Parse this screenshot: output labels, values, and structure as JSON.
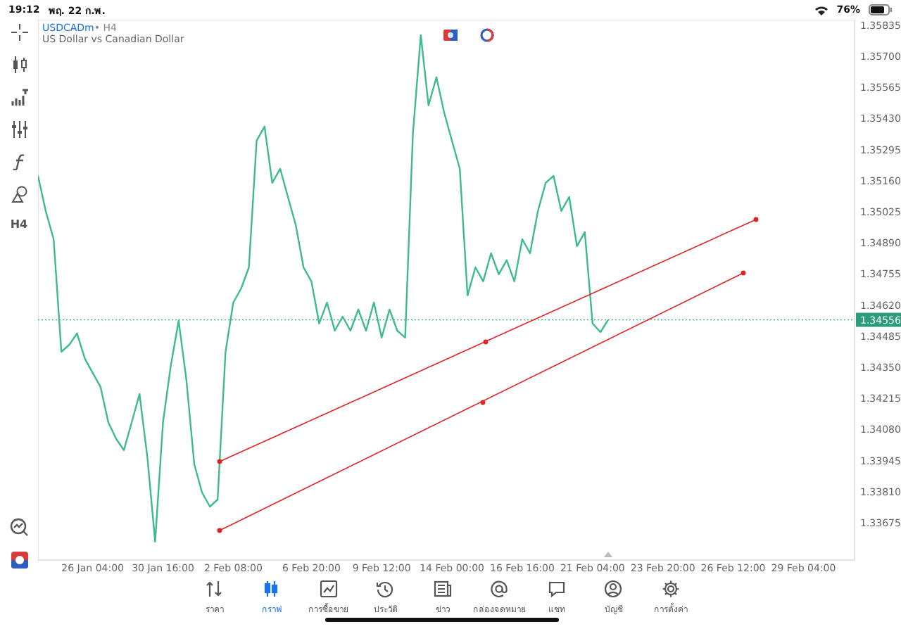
{
  "status_bar": {
    "time": "19:12",
    "date": "พฤ. 22 ก.พ.",
    "battery": "76%"
  },
  "toolbar": {
    "timeframe": "H4"
  },
  "chart": {
    "symbol": "USDCADm",
    "separator": "•",
    "timeframe": "H4",
    "description": "US Dollar vs Canadian Dollar",
    "current_price": "1.34556",
    "drawings": [
      {
        "kind": "trendline"
      },
      {
        "kind": "trendline"
      }
    ],
    "chart_data": {
      "type": "line",
      "ylim": [
        1.33513,
        1.35859
      ],
      "categories": [
        null,
        null,
        null,
        null,
        null,
        null,
        null,
        "26 Jan 04:00",
        null,
        null,
        null,
        null,
        null,
        null,
        null,
        null,
        "30 Jan 16:00",
        null,
        null,
        null,
        null,
        null,
        null,
        null,
        null,
        "2 Feb 08:00",
        null,
        null,
        null,
        null,
        null,
        null,
        null,
        null,
        null,
        "6 Feb 20:00",
        null,
        null,
        null,
        null,
        null,
        null,
        null,
        null,
        "9 Feb 12:00",
        null,
        null,
        null,
        null,
        null,
        null,
        null,
        null,
        "14 Feb 00:00",
        null,
        null,
        null,
        null,
        null,
        null,
        null,
        null,
        "16 Feb 16:00",
        null,
        null,
        null,
        null,
        null,
        null,
        null,
        null,
        "21 Feb 04:00",
        null,
        null,
        null,
        null,
        null,
        null,
        null,
        null,
        "23 Feb 20:00",
        null,
        null,
        null,
        null,
        null,
        null,
        null,
        null,
        "26 Feb 12:00",
        null,
        null,
        null,
        null,
        null,
        null,
        null,
        null,
        "29 Feb 04:00"
      ],
      "yticks": [
        {
          "value": 1.35835,
          "label": "1.35835"
        },
        {
          "value": 1.357,
          "label": "1.35700"
        },
        {
          "value": 1.35565,
          "label": "1.35565"
        },
        {
          "value": 1.3543,
          "label": "1.35430"
        },
        {
          "value": 1.35295,
          "label": "1.35295"
        },
        {
          "value": 1.3516,
          "label": "1.35160"
        },
        {
          "value": 1.35025,
          "label": "1.35025"
        },
        {
          "value": 1.3489,
          "label": "1.34890"
        },
        {
          "value": 1.34755,
          "label": "1.34755"
        },
        {
          "value": 1.3462,
          "label": "1.34620"
        },
        {
          "value": 1.34485,
          "label": "1.34485"
        },
        {
          "value": 1.3435,
          "label": "1.34350"
        },
        {
          "value": 1.34215,
          "label": "1.34215"
        },
        {
          "value": 1.3408,
          "label": "1.34080"
        },
        {
          "value": 1.33945,
          "label": "1.33945"
        },
        {
          "value": 1.3381,
          "label": "1.33810"
        },
        {
          "value": 1.33675,
          "label": "1.33675"
        }
      ],
      "series": [
        {
          "color": "#3dbb8c",
          "values": [
            1.35181,
            1.35028,
            1.34906,
            1.34417,
            1.34448,
            1.34497,
            1.34387,
            1.34326,
            1.34265,
            1.34112,
            1.34039,
            1.3399,
            1.34112,
            1.34234,
            1.33959,
            1.33593,
            1.34112,
            1.34356,
            1.34552,
            1.34295,
            1.33929,
            1.33806,
            1.33745,
            1.33776,
            1.34417,
            1.34631,
            1.34692,
            1.34784,
            1.35334,
            1.35395,
            1.35151,
            1.35212,
            1.3509,
            1.34967,
            1.34784,
            1.34723,
            1.3454,
            1.34631,
            1.34509,
            1.3457,
            1.34509,
            1.34601,
            1.34509,
            1.34631,
            1.34479,
            1.34601,
            1.34509,
            1.34479,
            1.35365,
            1.35792,
            1.35487,
            1.35609,
            1.35456,
            1.35334,
            1.35212,
            1.34662,
            1.34784,
            1.34723,
            1.34845,
            1.34754,
            1.34815,
            1.34723,
            1.34906,
            1.34845,
            1.35028,
            1.35151,
            1.35181,
            1.35028,
            1.3509,
            1.34876,
            1.34937,
            1.3454,
            1.34503,
            1.34556,
            null,
            null,
            null,
            null,
            null,
            null,
            null,
            null,
            null,
            null,
            null,
            null,
            null,
            null,
            null,
            null,
            null,
            null,
            null,
            null,
            null,
            null,
            null,
            null,
            null
          ]
        }
      ]
    }
  },
  "nav": [
    {
      "label": "ราคา",
      "selected": false
    },
    {
      "label": "กราฟ",
      "selected": true
    },
    {
      "label": "การซื้อขาย",
      "selected": false
    },
    {
      "label": "ประวัติ",
      "selected": false
    },
    {
      "label": "ข่าว",
      "selected": false
    },
    {
      "label": "กล่องจดหมาย",
      "selected": false
    },
    {
      "label": "แชท",
      "selected": false
    },
    {
      "label": "บัญชี",
      "selected": false
    },
    {
      "label": "การตั้งค่า",
      "selected": false
    }
  ]
}
